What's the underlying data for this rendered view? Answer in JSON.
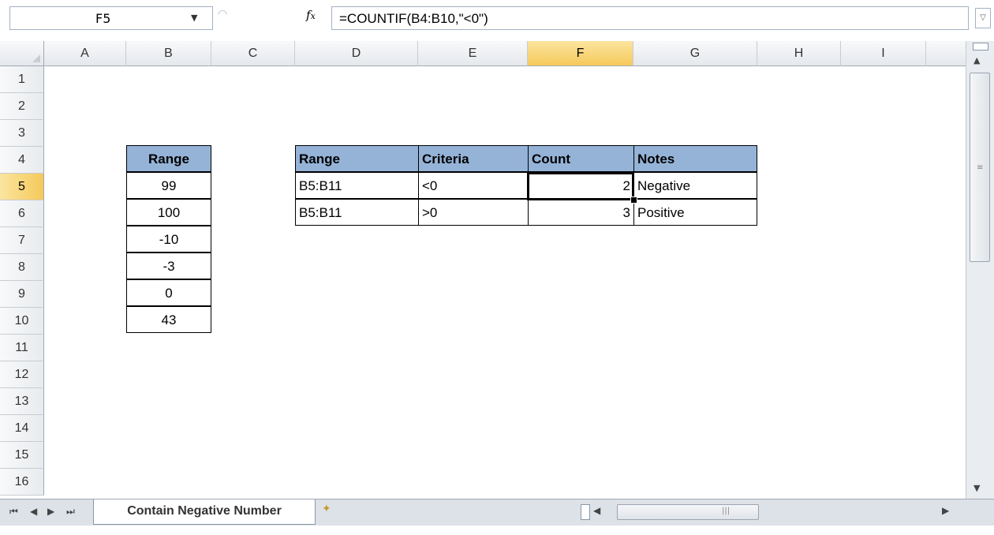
{
  "formula_bar": {
    "name_box": "F5",
    "fx_label": "fx",
    "formula": "=COUNTIF(B4:B10,\"<0\")"
  },
  "columns": [
    "A",
    "B",
    "C",
    "D",
    "E",
    "F",
    "G",
    "H",
    "I"
  ],
  "rows": [
    "1",
    "2",
    "3",
    "4",
    "5",
    "6",
    "7",
    "8",
    "9",
    "10",
    "11",
    "12",
    "13",
    "14",
    "15",
    "16"
  ],
  "selected": {
    "column": "F",
    "row": "5"
  },
  "range_table": {
    "header": "Range",
    "values": [
      "99",
      "100",
      "-10",
      "-3",
      "0",
      "43"
    ]
  },
  "count_table": {
    "headers": [
      "Range",
      "Criteria",
      "Count",
      "Notes"
    ],
    "rows": [
      [
        "B5:B11",
        "<0",
        "2",
        "Negative"
      ],
      [
        "B5:B11",
        ">0",
        "3",
        "Positive"
      ]
    ]
  },
  "sheet_tab": {
    "name": "Contain Negative Number"
  },
  "colors": {
    "header_fill": "#95b3d7",
    "selected_header": "#f5c95a"
  }
}
